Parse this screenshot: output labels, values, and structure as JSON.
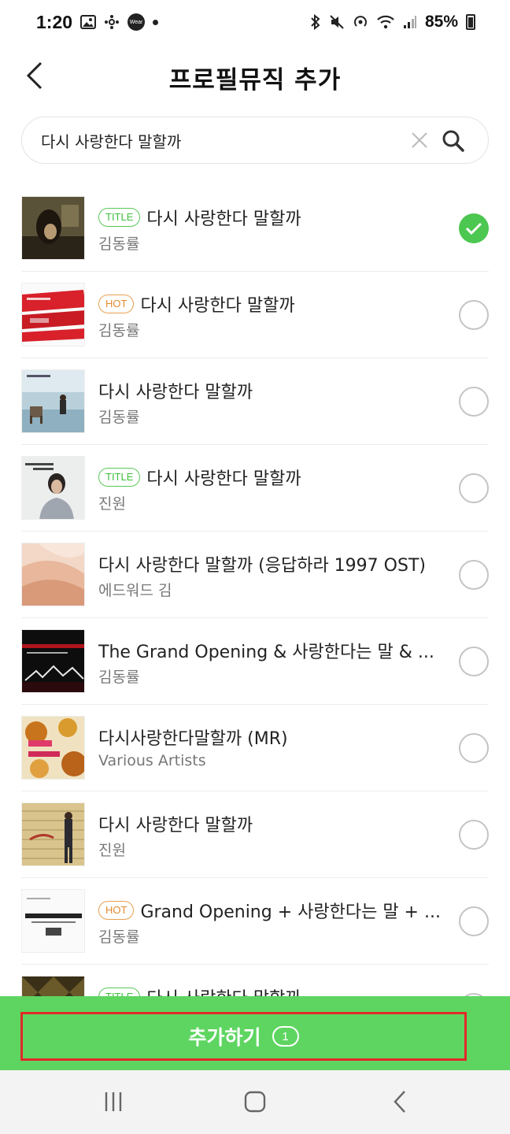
{
  "status_bar": {
    "time": "1:20",
    "wear_label": "Wear",
    "battery": "85%"
  },
  "header": {
    "title": "프로필뮤직 추가"
  },
  "search": {
    "value": "다시 사랑한다 말할까"
  },
  "songs": [
    {
      "tag": "TITLE",
      "title": "다시 사랑한다 말할까",
      "artist": "김동률",
      "selected": true
    },
    {
      "tag": "HOT",
      "title": "다시 사랑한다 말할까",
      "artist": "김동률",
      "selected": false
    },
    {
      "tag": "",
      "title": "다시 사랑한다 말할까",
      "artist": "김동률",
      "selected": false
    },
    {
      "tag": "TITLE",
      "title": "다시 사랑한다 말할까",
      "artist": "진원",
      "selected": false
    },
    {
      "tag": "",
      "title": "다시 사랑한다 말할까 (응답하라 1997 OST)",
      "artist": "에드워드 김",
      "selected": false
    },
    {
      "tag": "",
      "title": "The Grand Opening & 사랑한다는 말 & ...",
      "artist": "김동률",
      "selected": false
    },
    {
      "tag": "",
      "title": "다시사랑한다말할까 (MR)",
      "artist": "Various Artists",
      "selected": false
    },
    {
      "tag": "",
      "title": "다시 사랑한다 말할까",
      "artist": "진원",
      "selected": false
    },
    {
      "tag": "HOT",
      "title": "Grand Opening + 사랑한다는 말 + ...",
      "artist": "김동률",
      "selected": false
    },
    {
      "tag": "TITLE",
      "title": "다시 사랑한다 말할까",
      "artist": "",
      "selected": false
    }
  ],
  "add_bar": {
    "label": "추가하기",
    "count": "1"
  },
  "colors": {
    "accent_green": "#5ed561",
    "check_green": "#4cc751",
    "highlight_red": "#e02a2a"
  }
}
